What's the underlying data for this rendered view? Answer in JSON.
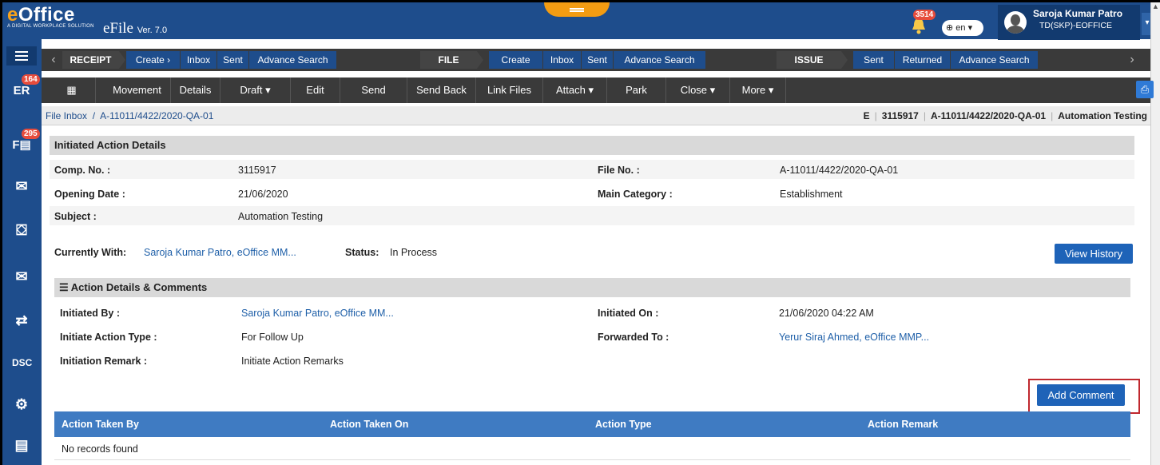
{
  "app": {
    "logo_text": "eOffice",
    "logo_tagline": "A DIGITAL WORKPLACE SOLUTION",
    "product": "eFile",
    "version": "Ver. 7.0"
  },
  "header": {
    "notification_count": "3514",
    "language": "en",
    "user_name": "Saroja Kumar Patro",
    "user_org": "TD(SKP)-EOFFICE"
  },
  "sidebar": {
    "items": [
      {
        "icon": "menu-icon"
      },
      {
        "icon": "receipt-icon",
        "badge": "164"
      },
      {
        "icon": "file-icon",
        "badge": "295"
      },
      {
        "icon": "dak-icon"
      },
      {
        "icon": "inbox-icon"
      },
      {
        "icon": "new-mail-icon"
      },
      {
        "icon": "transfer-icon"
      },
      {
        "icon": "dsc-icon"
      },
      {
        "icon": "settings-icon"
      },
      {
        "icon": "file-check-icon"
      }
    ]
  },
  "nav1": {
    "receipt": {
      "head": "RECEIPT",
      "items": [
        "Create",
        "Inbox",
        "Sent",
        "Advance Search"
      ]
    },
    "file": {
      "head": "FILE",
      "items": [
        "Create",
        "Inbox",
        "Sent",
        "Advance Search"
      ]
    },
    "issue": {
      "head": "ISSUE",
      "items": [
        "Sent",
        "Returned",
        "Advance Search"
      ]
    }
  },
  "toolbar": {
    "items": [
      "Movement",
      "Details",
      "Draft",
      "Edit",
      "Send",
      "Send Back",
      "Link Files",
      "Attach",
      "Park",
      "Close",
      "More"
    ]
  },
  "breadcrumb": {
    "root": "File Inbox",
    "current": "A-11011/4422/2020-QA-01",
    "right_type": "E",
    "right_comp": "3115917",
    "right_file": "A-11011/4422/2020-QA-01",
    "right_subject": "Automation Testing"
  },
  "initiated": {
    "title": "Initiated Action Details",
    "comp_no_label": "Comp. No. :",
    "comp_no": "3115917",
    "file_no_label": "File No. :",
    "file_no": "A-11011/4422/2020-QA-01",
    "opening_date_label": "Opening Date :",
    "opening_date": "21/06/2020",
    "main_category_label": "Main Category :",
    "main_category": "Establishment",
    "subject_label": "Subject :",
    "subject": "Automation Testing"
  },
  "status_row": {
    "currently_with_label": "Currently With:",
    "currently_with": "Saroja Kumar Patro, eOffice MM...",
    "status_label": "Status:",
    "status": "In Process",
    "view_history": "View History"
  },
  "action_details": {
    "title": "Action Details & Comments",
    "initiated_by_label": "Initiated By :",
    "initiated_by": "Saroja Kumar Patro, eOffice MM...",
    "initiated_on_label": "Initiated On :",
    "initiated_on": "21/06/2020 04:22 AM",
    "action_type_label": "Initiate Action Type :",
    "action_type": "For Follow Up",
    "forwarded_to_label": "Forwarded To :",
    "forwarded_to": "Yerur Siraj Ahmed, eOffice MMP...",
    "remark_label": "Initiation Remark :",
    "remark": "Initiate Action Remarks",
    "add_comment": "Add Comment"
  },
  "table": {
    "columns": [
      "Action Taken By",
      "Action Taken On",
      "Action Type",
      "Action Remark"
    ],
    "empty_text": "No records found"
  },
  "colors": {
    "header_blue": "#1e4d8c",
    "accent_orange": "#f39c12",
    "button_blue": "#1e63b8",
    "highlight_red": "#c0282e"
  }
}
